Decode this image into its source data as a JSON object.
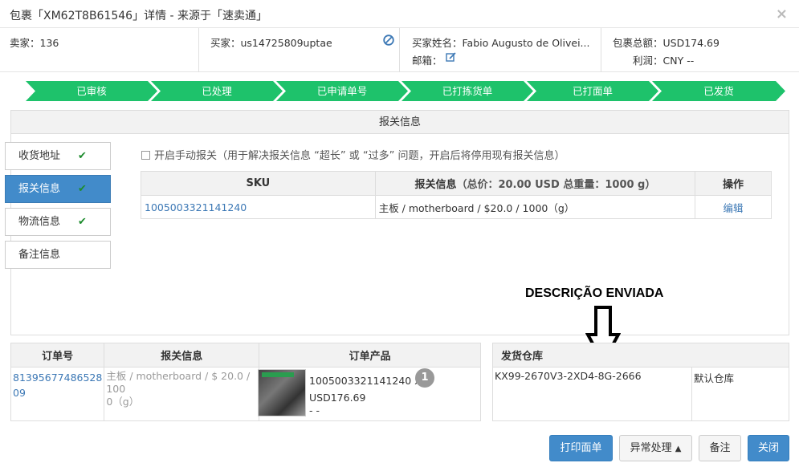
{
  "window": {
    "title": "包裹「XM62T8B61546」详情 - 来源于「速卖通」",
    "close": "×"
  },
  "info": {
    "seller": "卖家：136",
    "buyer": "买家：us14725809uptae",
    "buyer_name": "买家姓名：Fabio Augusto de Olivei...",
    "email": "邮箱：",
    "total": "包裹总额：USD174.69",
    "profit": "利润：CNY --"
  },
  "steps": [
    "已审核",
    "已处理",
    "已申请单号",
    "已打拣货单",
    "已打面单",
    "已发货"
  ],
  "panel": {
    "title": "报关信息"
  },
  "tabs": [
    {
      "label": "收货地址",
      "check": "✔"
    },
    {
      "label": "报关信息",
      "check": "✔"
    },
    {
      "label": "物流信息",
      "check": "✔"
    },
    {
      "label": "备注信息",
      "check": ""
    }
  ],
  "manual": {
    "label": "开启手动报关（用于解决报关信息 “超长” 或 “过多” 问题，开启后将停用现有报关信息）"
  },
  "customs_table": {
    "headers": [
      "SKU",
      "报关信息",
      "（总价：20.00 USD 总重量：1000 g）",
      "操作"
    ],
    "rows": [
      {
        "sku": "1005003321141240",
        "info": "主板 / motherboard / $20.0 / 1000（g）",
        "action": "编辑"
      }
    ]
  },
  "order_table": {
    "headers": [
      "订单号",
      "报关信息",
      "订单产品"
    ],
    "order_no_1": "81395677486528",
    "order_no_2": "09",
    "customs_1": "主板 / motherboard / $ 20.0 / 100",
    "customs_2": "0（g）",
    "product_sku": "1005003321141240 x",
    "qty": "1",
    "price": "USD176.69",
    "dash": "- -"
  },
  "warehouse_table": {
    "header": "发货仓库",
    "sku": "KX99-2670V3-2XD4-8G-2666",
    "warehouse": "默认仓库"
  },
  "annotation": "DESCRIÇÃO ENVIADA",
  "buttons": {
    "print": "打印面单",
    "exception": "异常处理",
    "note": "备注",
    "close": "关闭"
  },
  "colors": {
    "step_green": "#1ec26b",
    "primary_blue": "#428bca",
    "link": "#3c78b5"
  }
}
